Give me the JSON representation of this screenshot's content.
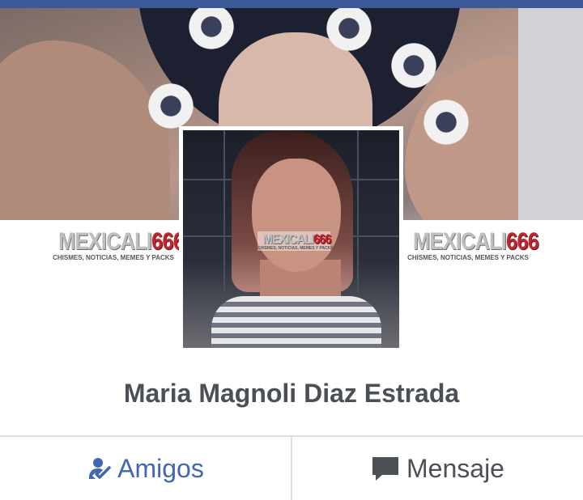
{
  "profile": {
    "name": "Maria Magnoli Diaz Estrada"
  },
  "watermark": {
    "brand": "MEXICALI",
    "number": "666",
    "tagline": "CHISMES, NOTICIAS, MEMES Y PACKS"
  },
  "actions": {
    "friends_label": "Amigos",
    "message_label": "Mensaje"
  },
  "icons": {
    "friends": "friend-check-icon",
    "message": "chat-bubble-icon"
  },
  "colors": {
    "top_bar": "#3b5998",
    "accent": "#4267b2",
    "text": "#4b4f56",
    "watermark_number": "#c0262d"
  }
}
